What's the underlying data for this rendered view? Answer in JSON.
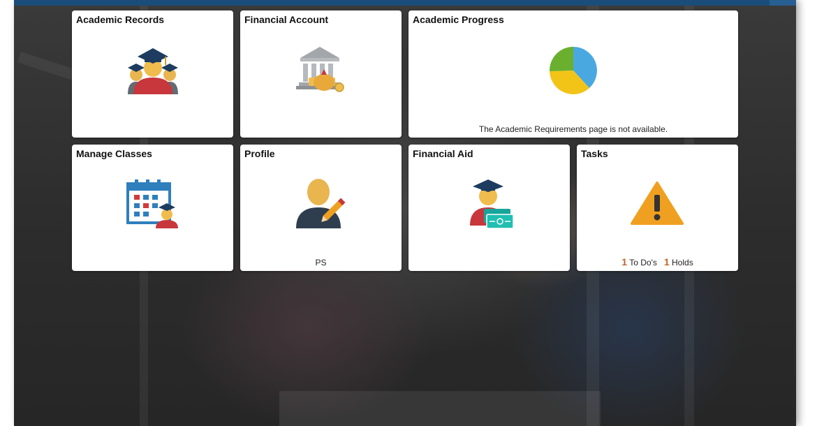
{
  "tiles": {
    "academic_records": {
      "title": "Academic Records",
      "icon": "students-graduation-icon"
    },
    "financial_account": {
      "title": "Financial Account",
      "icon": "bank-money-icon"
    },
    "academic_progress": {
      "title": "Academic Progress",
      "icon": "pie-chart-icon",
      "message": "The Academic Requirements page is not available."
    },
    "manage_classes": {
      "title": "Manage Classes",
      "icon": "calendar-student-icon"
    },
    "profile": {
      "title": "Profile",
      "icon": "user-edit-icon",
      "initials": "PS"
    },
    "financial_aid": {
      "title": "Financial Aid",
      "icon": "graduate-money-icon"
    },
    "tasks": {
      "title": "Tasks",
      "icon": "warning-icon",
      "todo_count": "1",
      "todo_label": "To Do's",
      "holds_count": "1",
      "holds_label": "Holds"
    }
  },
  "colors": {
    "header": "#1b4d7a",
    "tile_bg": "#ffffff",
    "accent_count": "#c0662a",
    "warning": "#f0a020",
    "pie_blue": "#4aa8e0",
    "pie_yellow": "#f2c418",
    "pie_green": "#6ab02e"
  }
}
